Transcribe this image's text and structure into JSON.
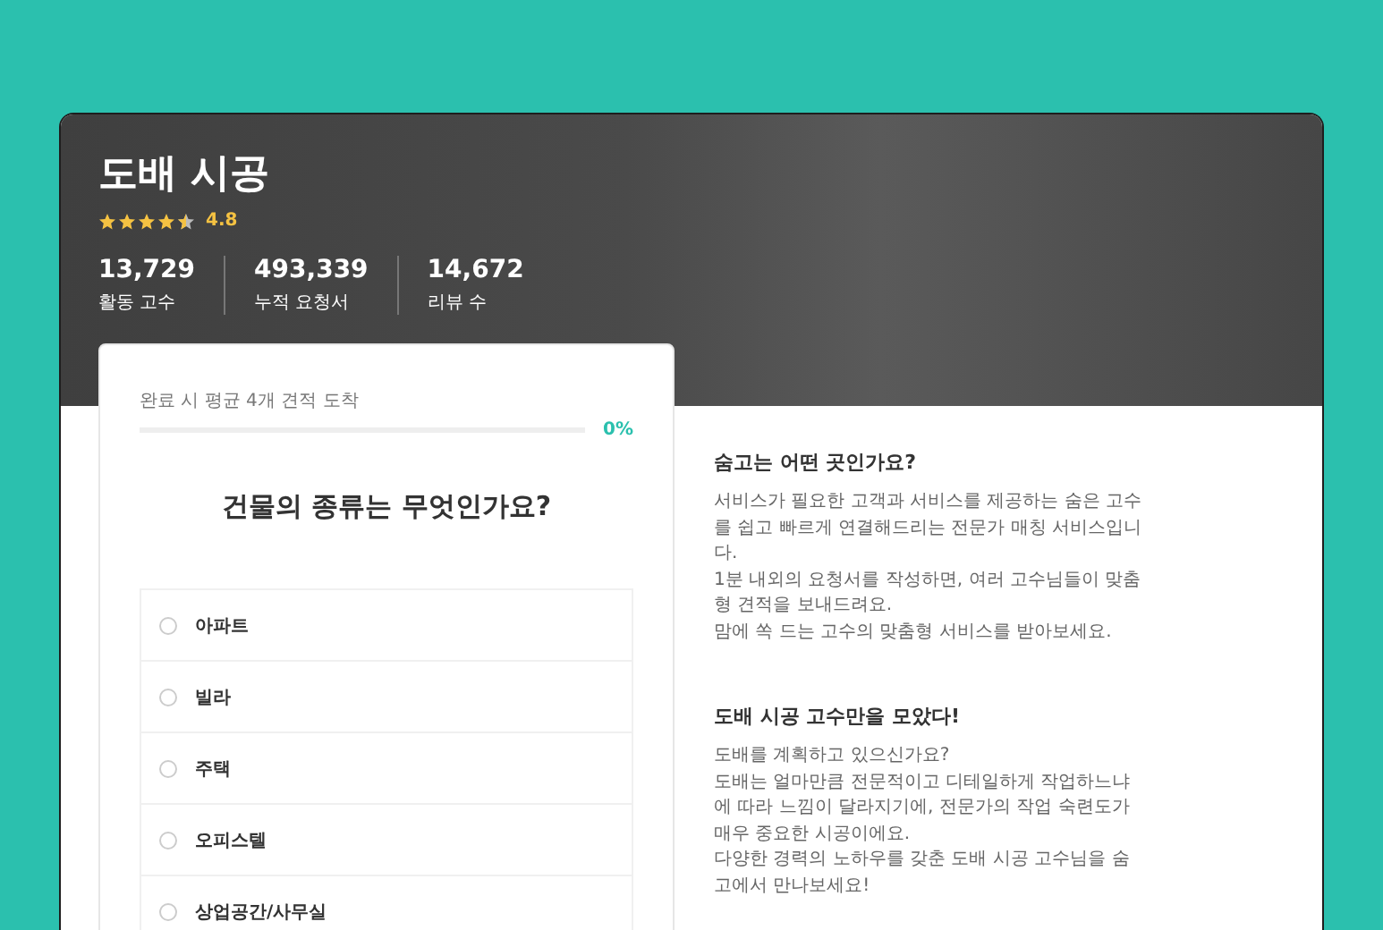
{
  "hero": {
    "title": "도배 시공",
    "stars": 4.5,
    "rating": "4.8",
    "stats": [
      {
        "value": "13,729",
        "label": "활동 고수"
      },
      {
        "value": "493,339",
        "label": "누적 요청서"
      },
      {
        "value": "14,672",
        "label": "리뷰 수"
      }
    ]
  },
  "survey": {
    "progress_label": "완료 시 평균 4개 견적 도착",
    "level": 0,
    "progress_text": "0%",
    "question": "건물의 종류는 무엇인가요?",
    "options": [
      {
        "label": "아파트",
        "selected": false
      },
      {
        "label": "빌라",
        "selected": false
      },
      {
        "label": "주택",
        "selected": false
      },
      {
        "label": "오피스텔",
        "selected": false
      },
      {
        "label": "상업공간/사무실",
        "selected": false
      }
    ]
  },
  "info": [
    {
      "heading": "숨고는 어떤 곳인가요?",
      "lines": [
        "서비스가 필요한 고객과 서비스를 제공하는 숨은 고수를 쉽고 빠르게 연결해드리는 전문가 매칭 서비스입니다.",
        "1분 내외의 요청서를 작성하면, 여러 고수님들이 맞춤형 견적을 보내드려요.",
        "맘에 쏙 드는 고수의 맞춤형 서비스를 받아보세요."
      ]
    },
    {
      "heading": "도배 시공 고수만을 모았다!",
      "lines": [
        "도배를 계획하고 있으신가요?",
        "도배는 얼마만큼 전문적이고 디테일하게 작업하느냐에 따라 느낌이 달라지기에, 전문가의 작업 숙련도가 매우 중요한 시공이에요.",
        "다양한 경력의 노하우를 갖춘 도배 시공 고수님을 숨고에서 만나보세요!"
      ]
    }
  ]
}
